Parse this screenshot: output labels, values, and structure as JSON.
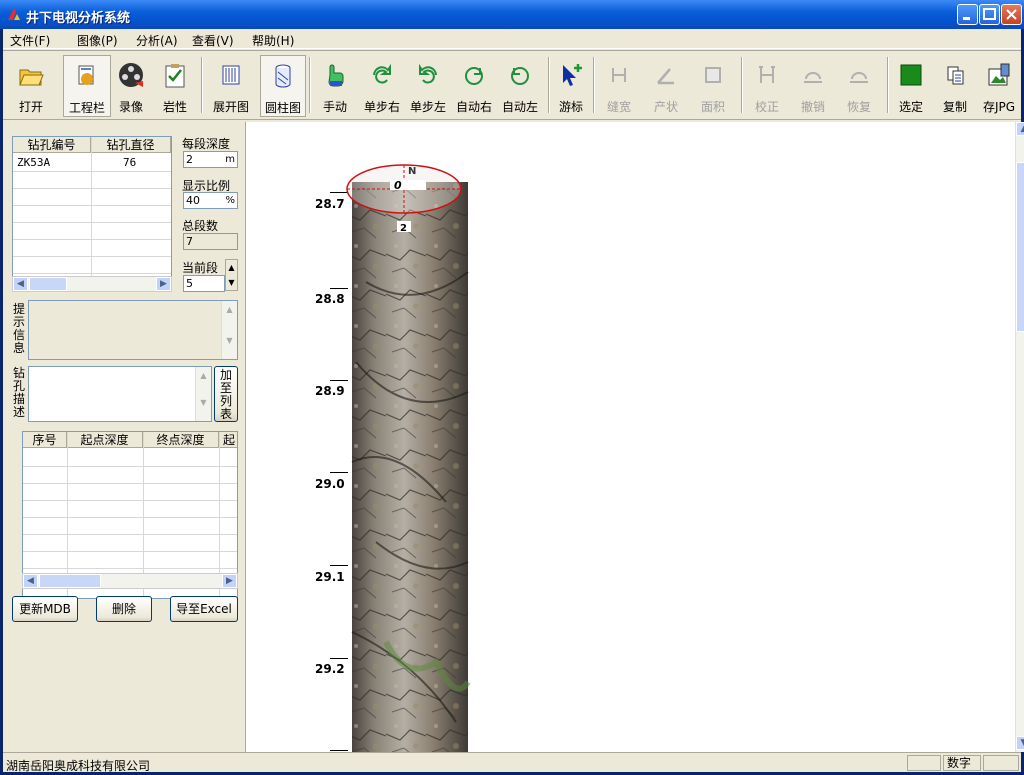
{
  "window": {
    "title": "井下电视分析系统"
  },
  "menu": [
    "文件(F)",
    "图像(P)",
    "分析(A)",
    "查看(V)",
    "帮助(H)"
  ],
  "toolbar": {
    "open": "打开",
    "project_bar": "工程栏",
    "record": "录像",
    "lithology": "岩性",
    "unroll": "展开图",
    "cylinder": "圆柱图",
    "manual": "手动",
    "step_right": "单步右",
    "step_left": "单步左",
    "auto_right": "自动右",
    "auto_left": "自动左",
    "cursor": "游标",
    "gap_width": "缝宽",
    "attitude": "产状",
    "area": "面积",
    "calibrate": "校正",
    "undo": "撤销",
    "redo": "恢复",
    "select": "选定",
    "copy": "复制",
    "save_jpg": "存JPG"
  },
  "borehole_table": {
    "headers": [
      "钻孔编号",
      "钻孔直径"
    ],
    "rows": [
      [
        "ZK53A",
        "76"
      ]
    ]
  },
  "params": {
    "seg_depth_label": "每段深度",
    "seg_depth_value": "2",
    "seg_depth_unit": "m",
    "scale_label": "显示比例",
    "scale_value": "40",
    "scale_unit": "%",
    "total_label": "总段数",
    "total_value": "7",
    "current_label": "当前段",
    "current_value": "5"
  },
  "hint_label": "提示信息",
  "desc_label": "钻孔描述",
  "add_to_list": "加至列表",
  "result_table": {
    "headers": [
      "序号",
      "起点深度",
      "终点深度",
      "起"
    ]
  },
  "buttons": {
    "update_mdb": "更新MDB",
    "delete": "删除",
    "export_excel": "导至Excel"
  },
  "depth_marks": [
    "28.7",
    "28.8",
    "28.9",
    "29.0",
    "29.1",
    "29.2"
  ],
  "compass": {
    "north": "N",
    "zero": "0",
    "bottom": "2"
  },
  "status": {
    "company": "湖南岳阳奥成科技有限公司",
    "mode": "数字"
  },
  "colors": {
    "title_blue": "#0a5fd8",
    "ellipse": "#d01010",
    "select_green": "#1a8a1a"
  }
}
